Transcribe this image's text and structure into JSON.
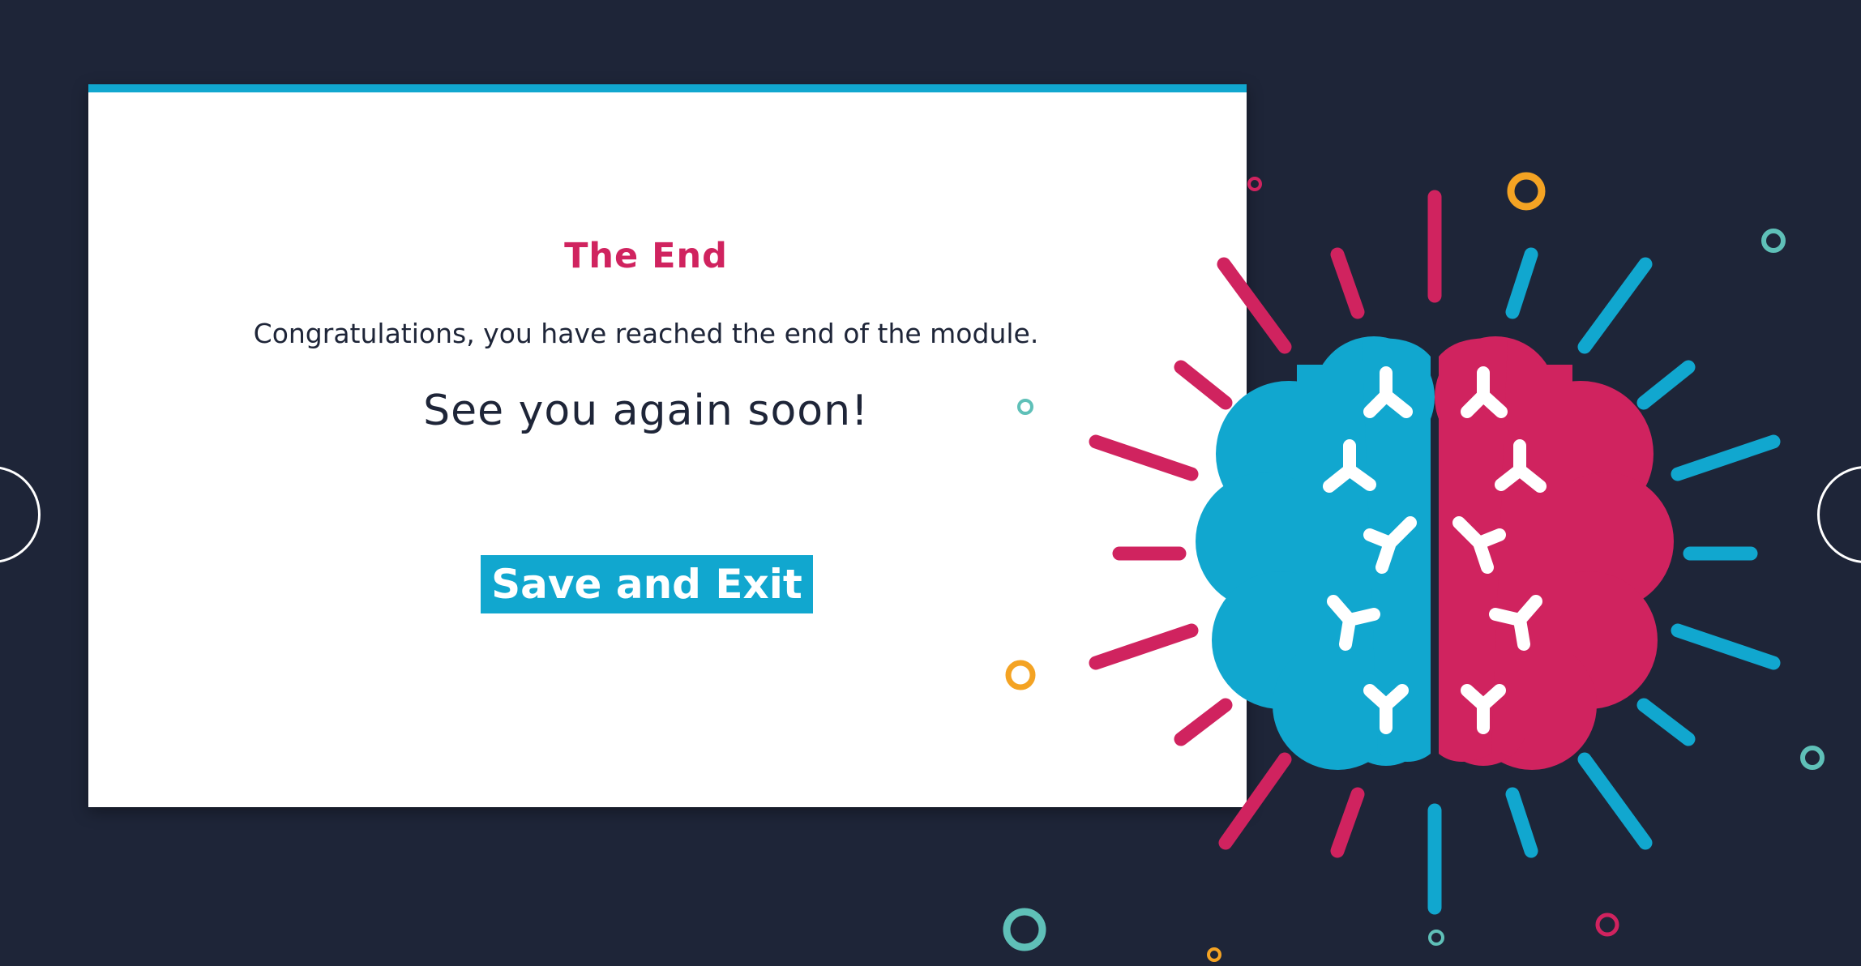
{
  "slide": {
    "title": "The End",
    "message": "Congratulations, you have reached the end of the module.",
    "farewell": "See you again soon!",
    "save_exit_label": "Save and Exit"
  },
  "colors": {
    "background": "#1e2538",
    "accent_blue": "#11a7cf",
    "accent_pink": "#d0235f",
    "accent_orange": "#f4a323",
    "accent_teal": "#5fc0b8",
    "card": "#ffffff"
  },
  "icons": {
    "illustration": "brain-icon",
    "prev": "previous-slide-button",
    "next": "next-slide-button"
  }
}
